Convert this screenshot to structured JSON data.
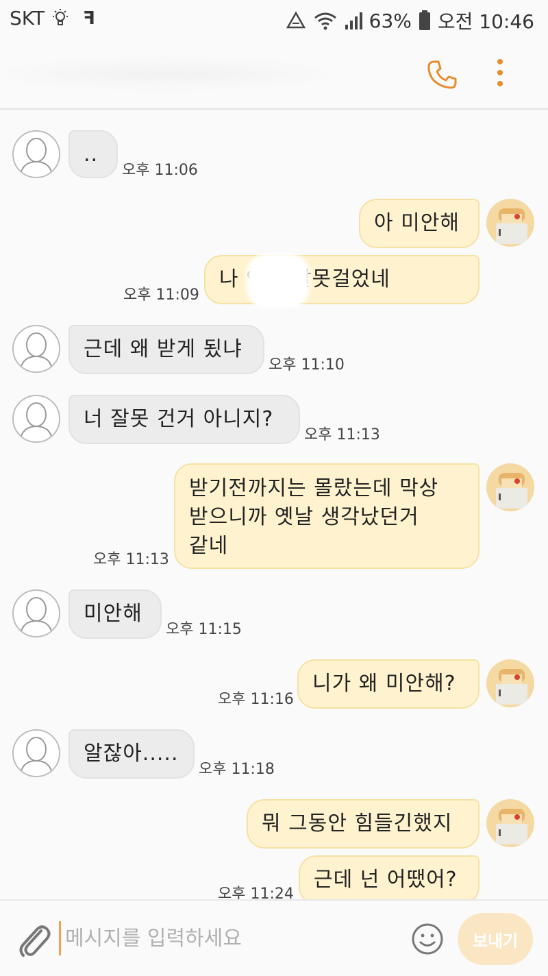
{
  "status_bar": {
    "carrier": "SKT",
    "battery_percent": "63%",
    "time": "오전 10:46",
    "icons": [
      "lightbulb-icon",
      "f-notification-icon",
      "recycle-icon",
      "wifi-icon",
      "signal-icon",
      "battery-icon"
    ]
  },
  "header": {
    "call_icon": "phone-icon",
    "menu_icon": "more-vertical-icon",
    "accent_color": "#e88b2e"
  },
  "messages": [
    {
      "direction": "in",
      "text": "..",
      "time": "오후 11:06"
    },
    {
      "direction": "out",
      "text": "아 미안해",
      "time": ""
    },
    {
      "direction": "out",
      "text": "나 인데 잘못걸었네",
      "time": "오후 11:09"
    },
    {
      "direction": "in",
      "text": "근데 왜 받게 됬냐",
      "time": "오후 11:10"
    },
    {
      "direction": "in",
      "text": "너 잘못 건거 아니지?",
      "time": "오후 11:13"
    },
    {
      "direction": "out",
      "text": "받기전까지는 몰랐는데 막상\n받으니까 옛날 생각났던거\n같네",
      "time": "오후 11:13"
    },
    {
      "direction": "in",
      "text": "미안해",
      "time": "오후 11:15"
    },
    {
      "direction": "out",
      "text": "니가 왜 미안해?",
      "time": "오후 11:16"
    },
    {
      "direction": "in",
      "text": "알잖아.....",
      "time": "오후 11:18"
    },
    {
      "direction": "out",
      "text": "뭐 그동안 힘들긴했지",
      "time": ""
    },
    {
      "direction": "out",
      "text": "근데 넌 어땠어?",
      "time": "오후 11:24"
    }
  ],
  "input_bar": {
    "placeholder": "메시지를 입력하세요",
    "send_label": "보내기",
    "attach_icon": "paperclip-icon",
    "emoji_icon": "smiley-icon"
  },
  "colors": {
    "incoming_bubble": "#ececec",
    "outgoing_bubble": "#fff3cf",
    "outgoing_border": "#f5e1a4",
    "send_button": "#fbe6c4"
  }
}
